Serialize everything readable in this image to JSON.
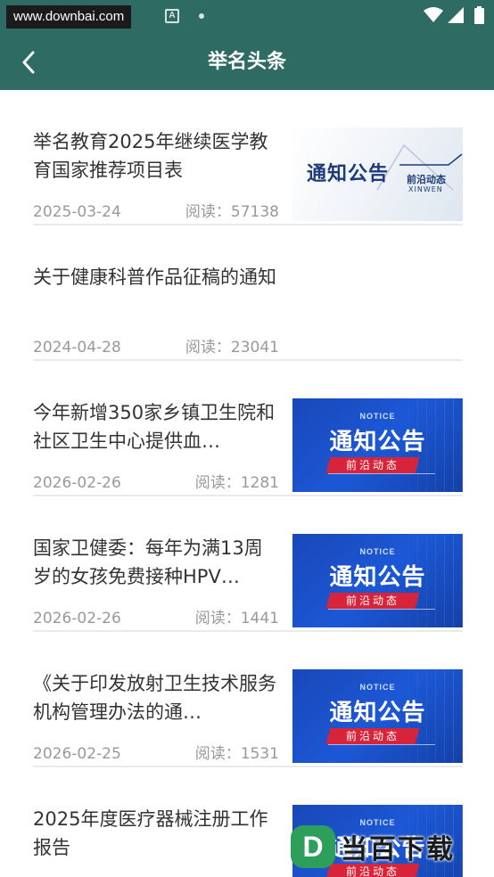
{
  "status_bar": {
    "watermark_url": "www.downbai.com",
    "notification_icon_letter": "A"
  },
  "header": {
    "title": "举名头条"
  },
  "news": [
    {
      "title": "举名教育2025年继续医学教育国家推荐项目表",
      "date": "2025-03-24",
      "reads": "阅读：57138",
      "thumbnail": "style-a"
    },
    {
      "title": "关于健康科普作品征稿的通知",
      "date": "2024-04-28",
      "reads": "阅读：23041",
      "thumbnail": "none"
    },
    {
      "title": "今年新增350家乡镇卫生院和社区卫生中心提供血…",
      "date": "2026-02-26",
      "reads": "阅读：1281",
      "thumbnail": "style-b"
    },
    {
      "title": "国家卫健委：每年为满13周岁的女孩免费接种HPV…",
      "date": "2026-02-26",
      "reads": "阅读：1441",
      "thumbnail": "style-b"
    },
    {
      "title": "《关于印发放射卫生技术服务机构管理办法的通…",
      "date": "2026-02-25",
      "reads": "阅读：1531",
      "thumbnail": "style-b"
    },
    {
      "title": "2025年度医疗器械注册工作报告",
      "date": "",
      "reads": "",
      "thumbnail": "style-b"
    }
  ],
  "thumbnail_a": {
    "main_text": "通知公告",
    "sub_text": "前沿动态",
    "english_text": "XINWEN"
  },
  "thumbnail_b": {
    "notice_text": "NOTICE",
    "main_text": "通知公告",
    "tag_text": "前沿动态"
  },
  "site_logo": {
    "mark": "D",
    "text": "当百下载"
  },
  "colors": {
    "header_bg": "#2e6b62",
    "title_text": "#333333",
    "meta_text": "#999999",
    "thumb_blue": "#1c58d6",
    "tag_red": "#d8243a"
  }
}
